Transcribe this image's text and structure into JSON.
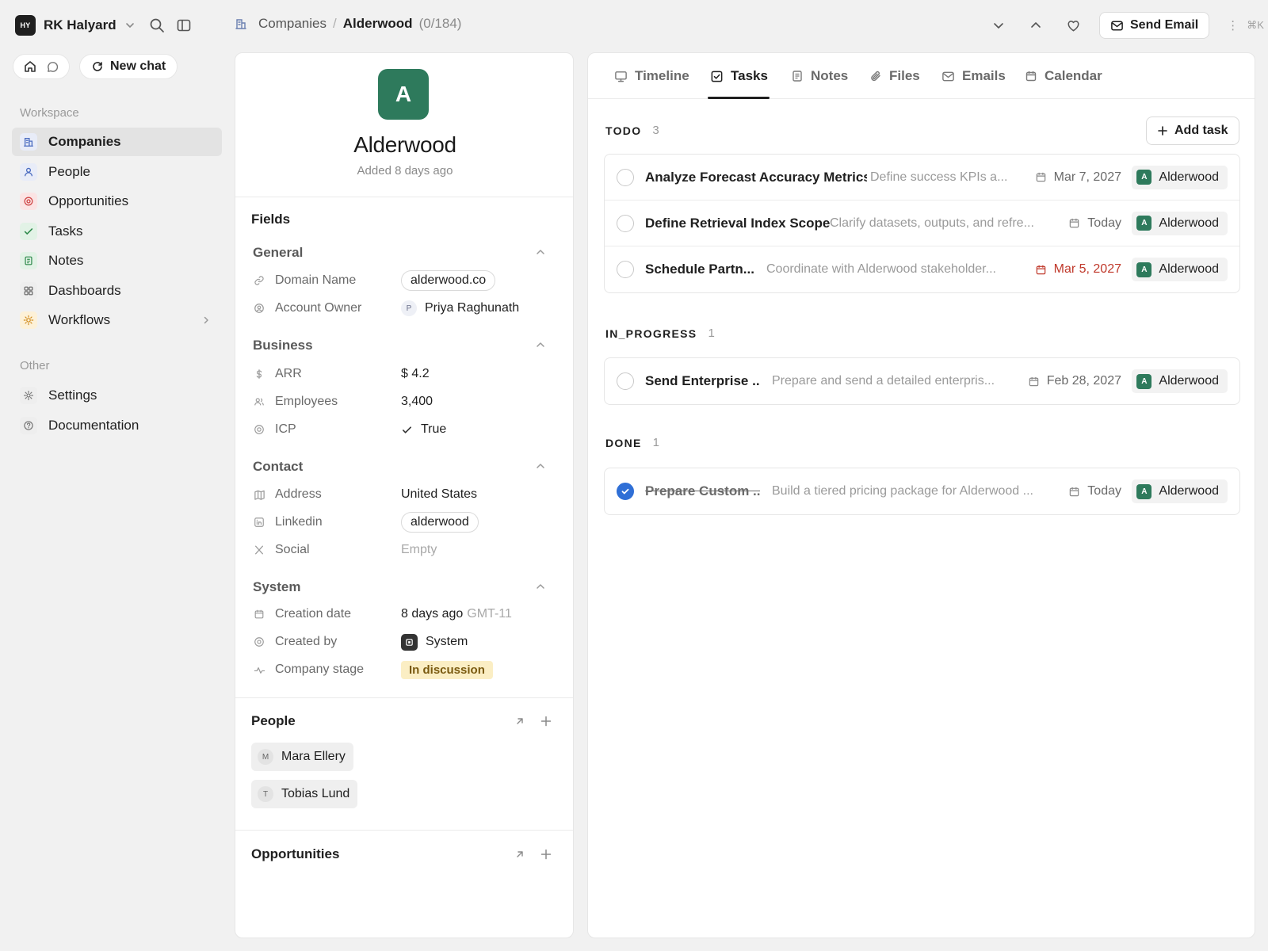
{
  "workspace": {
    "badge": "HY",
    "name": "RK Halyard"
  },
  "breadcrumb": {
    "section": "Companies",
    "separator": "/",
    "current": "Alderwood",
    "count": "(0/184)"
  },
  "topbar": {
    "send_email": "Send Email",
    "shortcut": "⌘K",
    "more": "⋮"
  },
  "sidebar": {
    "new_chat": "New chat",
    "workspace_label": "Workspace",
    "workspace_items": [
      {
        "label": "Companies",
        "icon": "building-icon",
        "color": "#e8ecf8"
      },
      {
        "label": "People",
        "icon": "person-icon",
        "color": "#e8ecf8"
      },
      {
        "label": "Opportunities",
        "icon": "target-icon",
        "color": "#fbe4e4"
      },
      {
        "label": "Tasks",
        "icon": "check-icon",
        "color": "#e2f2e6"
      },
      {
        "label": "Notes",
        "icon": "note-icon",
        "color": "#e2f2e6"
      },
      {
        "label": "Dashboards",
        "icon": "grid-icon",
        "color": "#eeeeee"
      },
      {
        "label": "Workflows",
        "icon": "sun-icon",
        "color": "#fdf1d8"
      }
    ],
    "other_label": "Other",
    "other_items": [
      {
        "label": "Settings",
        "icon": "gear-icon"
      },
      {
        "label": "Documentation",
        "icon": "help-icon"
      }
    ]
  },
  "record": {
    "avatar_letter": "A",
    "avatar_color": "#2e7a5c",
    "name": "Alderwood",
    "added": "Added 8 days ago",
    "fields_title": "Fields",
    "groups": {
      "general": {
        "title": "General",
        "domain_label": "Domain Name",
        "domain_value": "alderwood.co",
        "owner_label": "Account Owner",
        "owner_initial": "P",
        "owner_value": "Priya Raghunath"
      },
      "business": {
        "title": "Business",
        "arr_label": "ARR",
        "arr_value": "$ 4.2",
        "employees_label": "Employees",
        "employees_value": "3,400",
        "icp_label": "ICP",
        "icp_value": "True"
      },
      "contact": {
        "title": "Contact",
        "address_label": "Address",
        "address_value": "United States",
        "linkedin_label": "Linkedin",
        "linkedin_value": "alderwood",
        "social_label": "Social",
        "social_value": "Empty"
      },
      "system": {
        "title": "System",
        "creation_label": "Creation date",
        "creation_value": "8 days ago",
        "creation_tz": "GMT-11",
        "created_by_label": "Created by",
        "created_by_value": "System",
        "stage_label": "Company stage",
        "stage_value": "In discussion"
      }
    },
    "people_title": "People",
    "people": [
      {
        "initial": "M",
        "name": "Mara Ellery"
      },
      {
        "initial": "T",
        "name": "Tobias Lund"
      }
    ],
    "opportunities_title": "Opportunities"
  },
  "tabs": [
    {
      "label": "Timeline",
      "icon": "monitor-icon"
    },
    {
      "label": "Tasks",
      "icon": "checkbox-icon"
    },
    {
      "label": "Notes",
      "icon": "note-icon"
    },
    {
      "label": "Files",
      "icon": "paperclip-icon"
    },
    {
      "label": "Emails",
      "icon": "mail-icon"
    },
    {
      "label": "Calendar",
      "icon": "calendar-icon"
    }
  ],
  "active_tab": "Tasks",
  "add_task": "Add task",
  "task_groups": [
    {
      "name": "TODO",
      "count": "3",
      "tasks": [
        {
          "title": "Analyze Forecast Accuracy Metrics",
          "desc": "Define success KPIs a...",
          "date": "Mar 7, 2027",
          "company": "Alderwood",
          "done": false,
          "overdue": false
        },
        {
          "title": "Define Retrieval Index Scope",
          "desc": "Clarify datasets, outputs, and refre...",
          "date": "Today",
          "company": "Alderwood",
          "done": false,
          "overdue": false
        },
        {
          "title": "Schedule Partn...",
          "desc": "Coordinate with Alderwood stakeholder...",
          "date": "Mar 5, 2027",
          "company": "Alderwood",
          "done": false,
          "overdue": true
        }
      ]
    },
    {
      "name": "IN_PROGRESS",
      "count": "1",
      "tasks": [
        {
          "title": "Send Enterprise ...",
          "desc": "Prepare and send a detailed enterpris...",
          "date": "Feb 28, 2027",
          "company": "Alderwood",
          "done": false,
          "overdue": false
        }
      ]
    },
    {
      "name": "DONE",
      "count": "1",
      "tasks": [
        {
          "title": "Prepare Custom ...",
          "desc": "Build a tiered pricing package for Alderwood ...",
          "date": "Today",
          "company": "Alderwood",
          "done": true,
          "overdue": false
        }
      ]
    }
  ]
}
